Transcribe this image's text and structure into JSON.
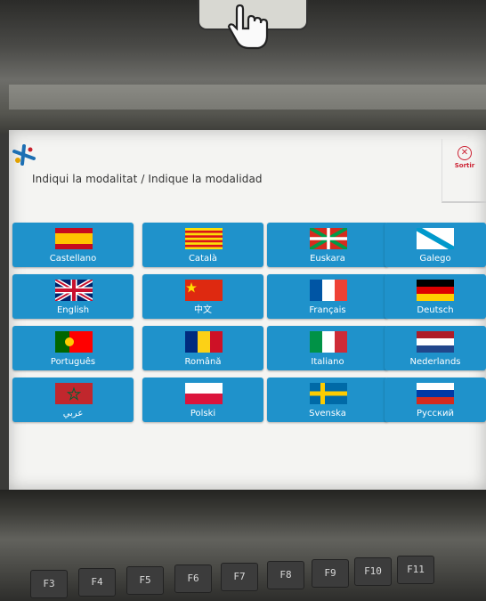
{
  "header": {
    "title": "Indiqui la modalitat / Indique la modalidad",
    "exit_label": "Sortir",
    "exit_icon": "close-circle-icon"
  },
  "languages": [
    {
      "label": "Castellano",
      "flag": "flag-spain-icon"
    },
    {
      "label": "Català",
      "flag": "flag-catalonia-icon"
    },
    {
      "label": "Euskara",
      "flag": "flag-basque-icon"
    },
    {
      "label": "Galego",
      "flag": "flag-galicia-icon"
    },
    {
      "label": "English",
      "flag": "flag-uk-icon"
    },
    {
      "label": "中文",
      "flag": "flag-china-icon"
    },
    {
      "label": "Français",
      "flag": "flag-france-icon"
    },
    {
      "label": "Deutsch",
      "flag": "flag-germany-icon"
    },
    {
      "label": "Português",
      "flag": "flag-portugal-icon"
    },
    {
      "label": "Română",
      "flag": "flag-romania-icon"
    },
    {
      "label": "Italiano",
      "flag": "flag-italy-icon"
    },
    {
      "label": "Nederlands",
      "flag": "flag-netherlands-icon"
    },
    {
      "label": "عربي",
      "flag": "flag-morocco-icon"
    },
    {
      "label": "Polski",
      "flag": "flag-poland-icon"
    },
    {
      "label": "Svenska",
      "flag": "flag-sweden-icon"
    },
    {
      "label": "Русский",
      "flag": "flag-russia-icon"
    }
  ],
  "function_keys": [
    "F3",
    "F4",
    "F5",
    "F6",
    "F7",
    "F8",
    "F9",
    "F10",
    "F11"
  ],
  "colors": {
    "button_blue": "#1f92cb",
    "exit_red": "#cc2233",
    "screen_bg": "#f4f4f2"
  }
}
